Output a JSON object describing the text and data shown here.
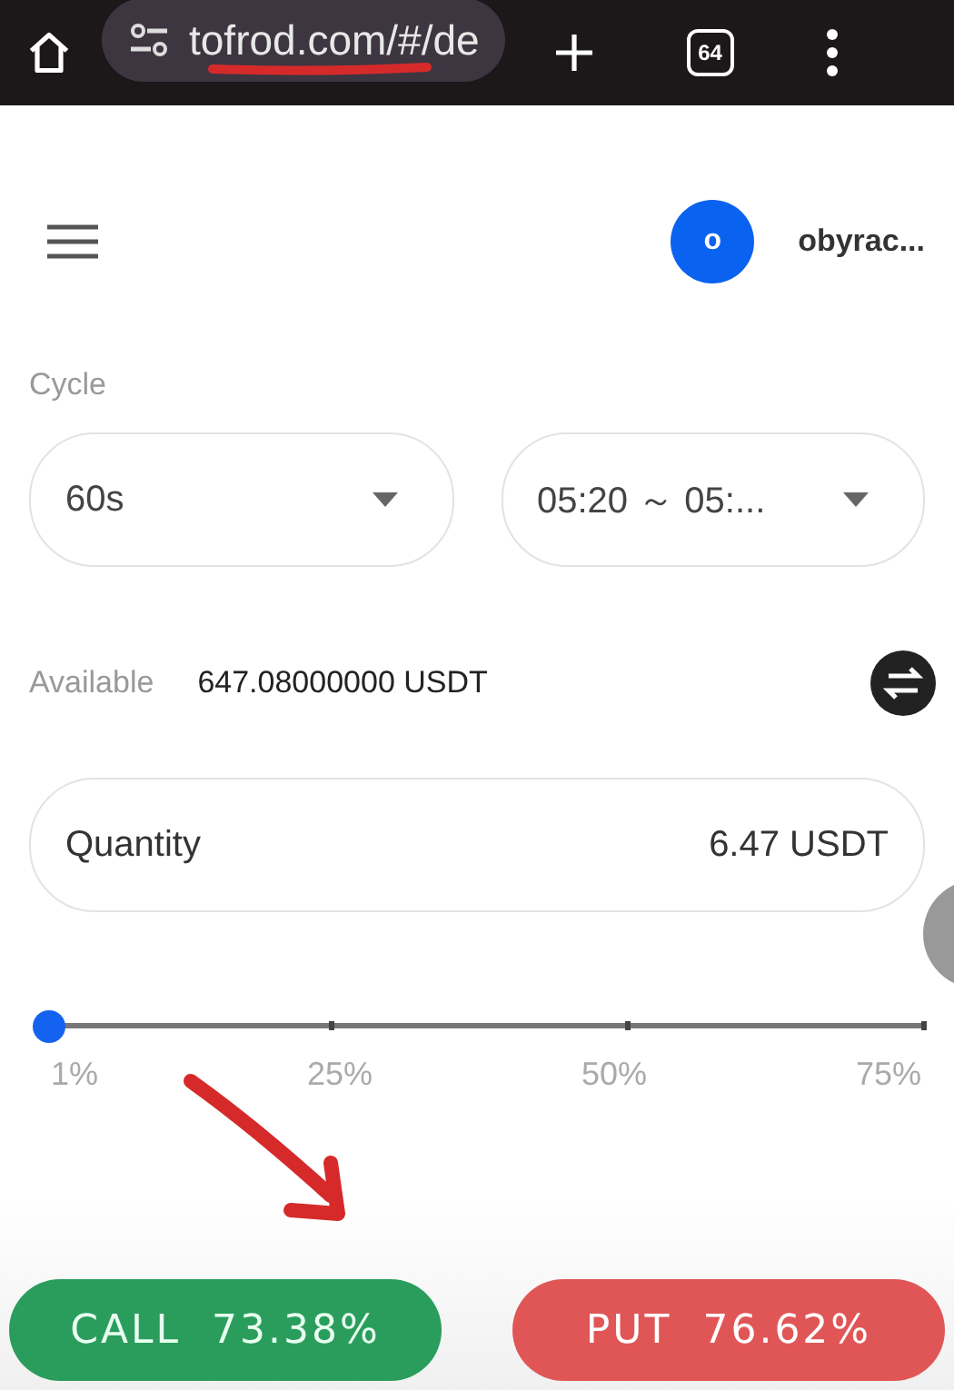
{
  "browser_bar": {
    "url": "tofrod.com/#/de",
    "tab_count": "64"
  },
  "header": {
    "avatar_letter": "o",
    "username": "obyrac..."
  },
  "cycle": {
    "label": "Cycle",
    "selects": [
      {
        "value": "60s"
      },
      {
        "value": "05:20 ～ 05:..."
      }
    ]
  },
  "available": {
    "label": "Available",
    "value": "647.08000000 USDT"
  },
  "quantity": {
    "label": "Quantity",
    "value": "6.47 USDT"
  },
  "slider": {
    "level": 0.0,
    "ticks": [
      "1%",
      "25%",
      "50%",
      "75%"
    ]
  },
  "actions": [
    {
      "kind": "call",
      "label": "CALL",
      "percent": "73.38%"
    },
    {
      "kind": "put",
      "label": "PUT",
      "percent": "76.62%"
    }
  ]
}
